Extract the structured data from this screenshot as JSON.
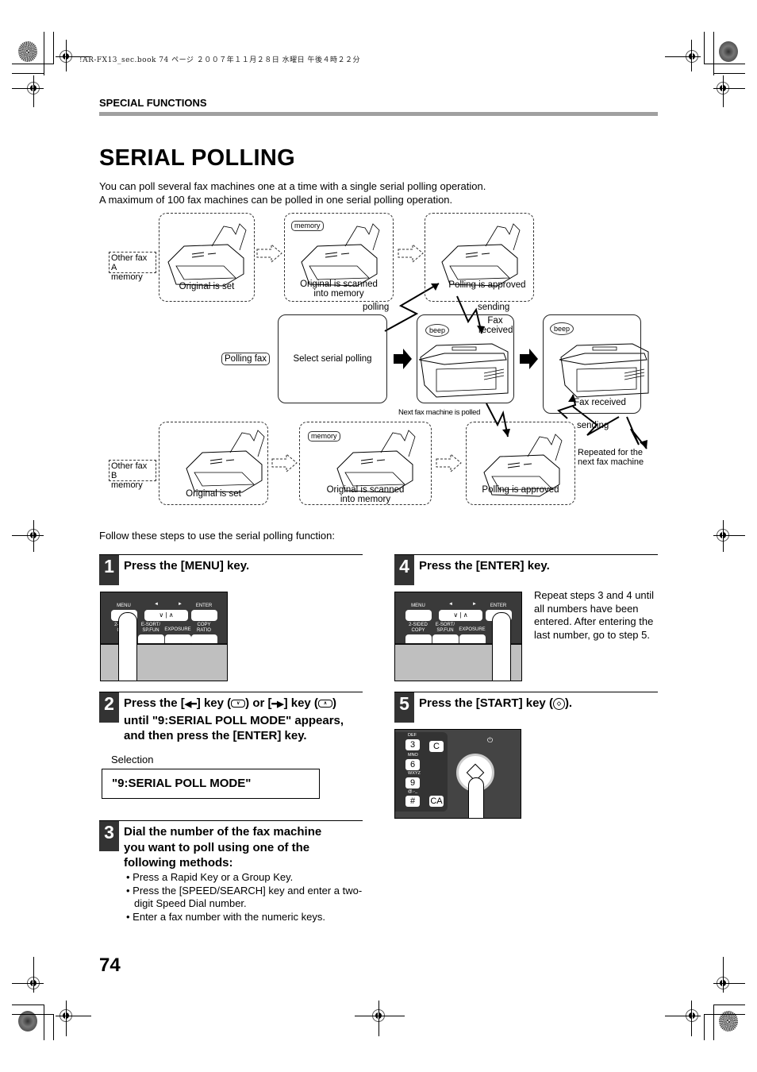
{
  "print_header": "!AR-FX13_sec.book  74 ページ  ２００７年１１月２８日  水曜日  午後４時２２分",
  "section_label": "SPECIAL FUNCTIONS",
  "page_title": "SERIAL POLLING",
  "intro": [
    "You can poll several fax machines one at a time with a single serial polling operation.",
    "A maximum of 100 fax machines can be polled in one serial polling operation."
  ],
  "diagram": {
    "row_a": {
      "side_label": [
        "Other fax A",
        "memory"
      ],
      "boxes": [
        {
          "label": [
            "Original is set"
          ]
        },
        {
          "label": [
            "Original is scanned",
            "into memory"
          ],
          "tag": "memory"
        },
        {
          "label": [
            "Polling is approved"
          ]
        }
      ]
    },
    "middle": {
      "side_label": "Polling fax",
      "select_box": "Select serial polling",
      "polling": "polling",
      "sending": "sending",
      "fax_received_top": [
        "Fax",
        "received"
      ],
      "beep": "beep",
      "fax_received": "Fax received",
      "next_polled": "Next fax machine is polled"
    },
    "row_b": {
      "side_label": [
        "Other fax B",
        "memory"
      ],
      "boxes": [
        {
          "label": [
            "Original is set"
          ]
        },
        {
          "label": [
            "Original is scanned",
            "into memory"
          ],
          "tag": "memory"
        },
        {
          "label": [
            "Polling is approved"
          ]
        }
      ],
      "sending": "sending",
      "repeated": [
        "Repeated for the",
        "next fax machine"
      ]
    }
  },
  "steps_intro": "Follow these steps to use the serial polling function:",
  "panel_labels": {
    "menu": "MENU",
    "enter": "ENTER",
    "left": "◄",
    "right": "►",
    "down": "∨",
    "up": "∧",
    "two_sided": [
      "2-SIDED",
      "COPY"
    ],
    "esort": [
      "E-SORT/",
      "SP.FUN"
    ],
    "exposure": "EXPOSURE",
    "copy_ratio": [
      "COPY",
      "RATIO"
    ]
  },
  "steps": [
    {
      "num": "1",
      "title": "Press the [MENU] key."
    },
    {
      "num": "2",
      "title_parts": [
        "Press the [",
        "] key (",
        ") or [",
        "] key (",
        ")",
        "until \"9:SERIAL POLL MODE\" appears,",
        "and then press the [ENTER] key."
      ],
      "selection_label": "Selection",
      "selection_value": "\"9:SERIAL POLL MODE\""
    },
    {
      "num": "3",
      "title": [
        "Dial the number of the fax machine",
        "you want to poll using one of the",
        "following methods:"
      ],
      "bullets": [
        "Press a Rapid Key or a Group Key.",
        "Press the [SPEED/SEARCH] key and enter a two-digit Speed Dial number.",
        "Enter a fax number with the numeric keys."
      ]
    },
    {
      "num": "4",
      "title": "Press the [ENTER] key.",
      "note": "Repeat steps 3 and 4 until all numbers have been entered. After entering the last number, go to step 5."
    },
    {
      "num": "5",
      "title_parts": [
        "Press the  [START] key (",
        ")."
      ],
      "keypad": [
        {
          "sub": "DEF",
          "key": "3"
        },
        {
          "sub": "MNO",
          "key": "6"
        },
        {
          "sub": "WXYZ",
          "key": "9"
        },
        {
          "sub": "@.-_",
          "key": "#"
        }
      ],
      "keys_right": [
        "C",
        "CA"
      ]
    }
  ],
  "page_number": "74"
}
